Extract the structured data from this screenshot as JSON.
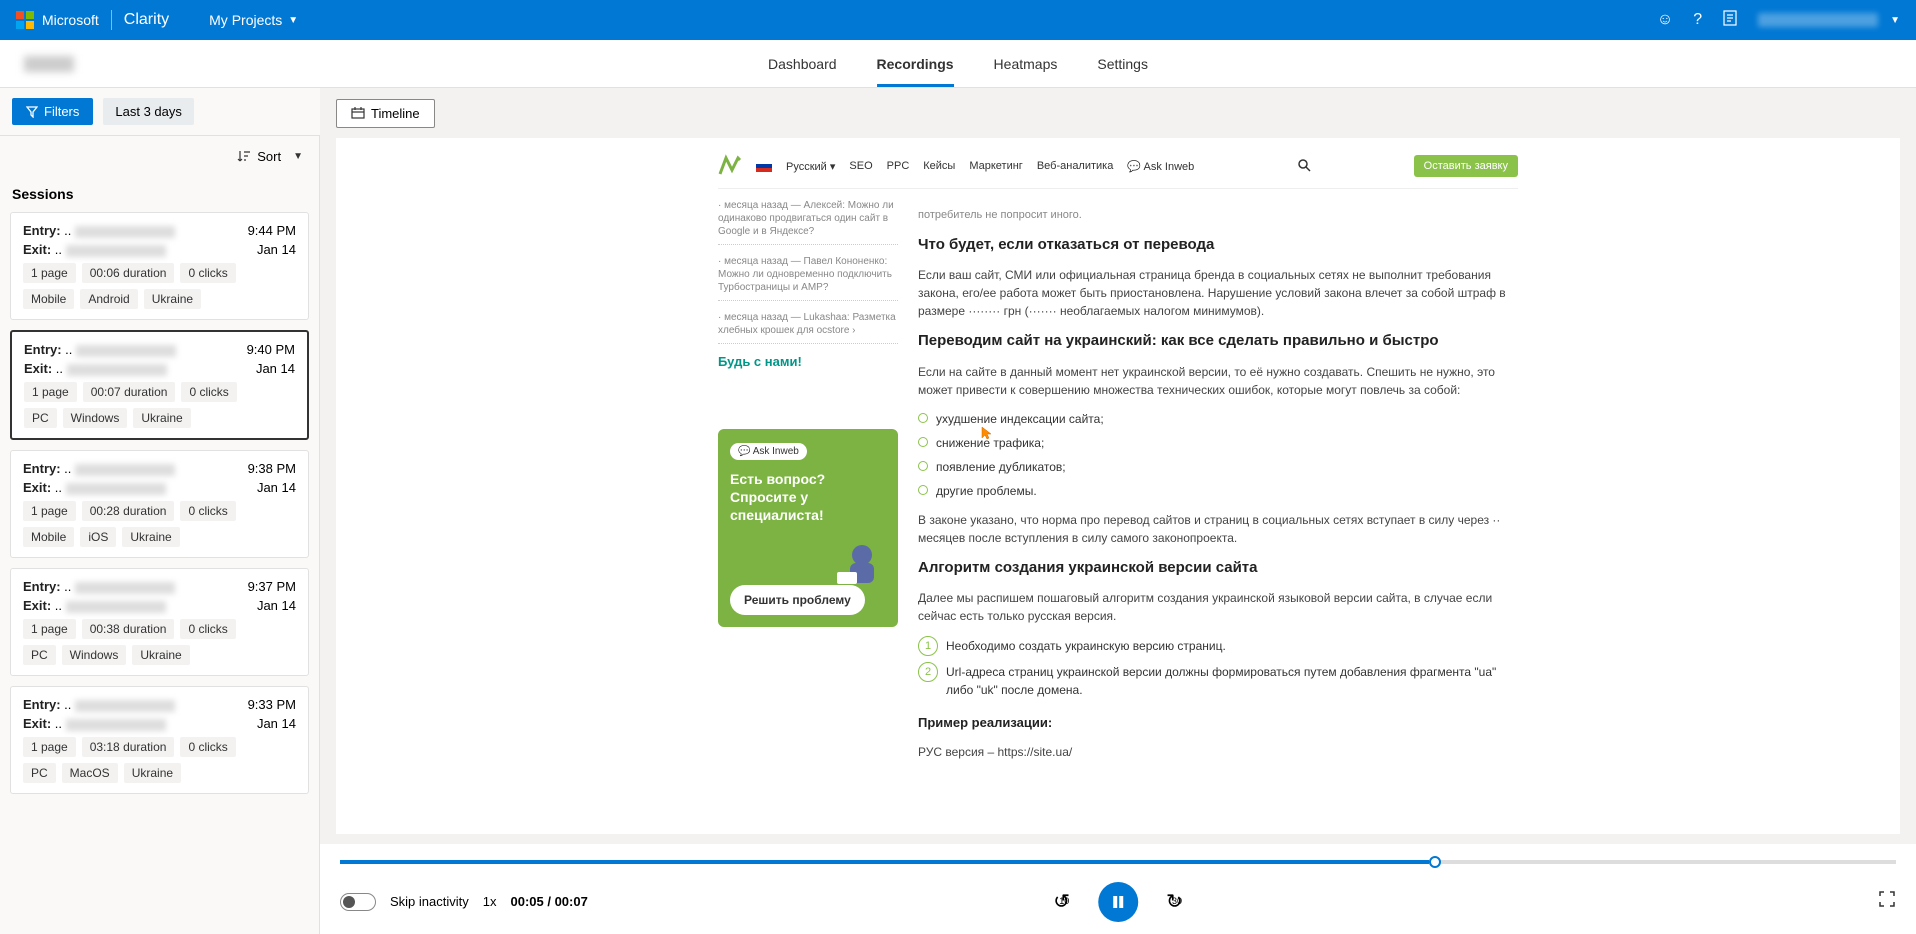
{
  "header": {
    "microsoft": "Microsoft",
    "brand": "Clarity",
    "projects": "My Projects"
  },
  "nav": {
    "dashboard": "Dashboard",
    "recordings": "Recordings",
    "heatmaps": "Heatmaps",
    "settings": "Settings"
  },
  "filters": {
    "button": "Filters",
    "chip": "Last 3 days"
  },
  "sort": "Sort",
  "timeline": "Timeline",
  "sessions_title": "Sessions",
  "sessions": [
    {
      "entry": "Entry:",
      "exit": "Exit:",
      "time": "9:44 PM",
      "date": "Jan 14",
      "pages": "1 page",
      "duration": "00:06 duration",
      "clicks": "0 clicks",
      "tags": [
        "Mobile",
        "Android",
        "Ukraine"
      ],
      "selected": false
    },
    {
      "entry": "Entry:",
      "exit": "Exit:",
      "time": "9:40 PM",
      "date": "Jan 14",
      "pages": "1 page",
      "duration": "00:07 duration",
      "clicks": "0 clicks",
      "tags": [
        "PC",
        "Windows",
        "Ukraine"
      ],
      "selected": true
    },
    {
      "entry": "Entry:",
      "exit": "Exit:",
      "time": "9:38 PM",
      "date": "Jan 14",
      "pages": "1 page",
      "duration": "00:28 duration",
      "clicks": "0 clicks",
      "tags": [
        "Mobile",
        "iOS",
        "Ukraine"
      ],
      "selected": false
    },
    {
      "entry": "Entry:",
      "exit": "Exit:",
      "time": "9:37 PM",
      "date": "Jan 14",
      "pages": "1 page",
      "duration": "00:38 duration",
      "clicks": "0 clicks",
      "tags": [
        "PC",
        "Windows",
        "Ukraine"
      ],
      "selected": false
    },
    {
      "entry": "Entry:",
      "exit": "Exit:",
      "time": "9:33 PM",
      "date": "Jan 14",
      "pages": "1 page",
      "duration": "03:18 duration",
      "clicks": "0 clicks",
      "tags": [
        "PC",
        "MacOS",
        "Ukraine"
      ],
      "selected": false
    }
  ],
  "controls": {
    "skip": "Skip inactivity",
    "speed": "1x",
    "time": "00:05 / 00:07",
    "back": "10",
    "fwd": "30"
  },
  "replay": {
    "nav": {
      "lang": "Русский",
      "seo": "SEO",
      "ppc": "PPC",
      "cases": "Кейсы",
      "marketing": "Маркетинг",
      "web": "Веб-аналитика",
      "ask": "Ask Inweb",
      "cta": "Оставить заявку"
    },
    "side_title": "Будь с нами!",
    "side_items": [
      "· месяца назад — Алексей: Можно ли одинаково продвигаться один сайт в Google и в Яндексе?",
      "· месяца назад — Павел Кононенко: Можно ли одновременно подключить Турбостраницы и AMP?",
      "· месяца назад — Lukashaa: Разметка хлебных крошек для ocstore ›"
    ],
    "promo_ask": "Ask Inweb",
    "promo_h": "Есть вопрос? Спросите у специалиста!",
    "promo_btn": "Решить проблему",
    "h1": "Что будет, если отказаться от перевода",
    "p1": "Если ваш сайт, СМИ или официальная страница бренда в социальных сетях не выполнит требования закона, его/ее работа может быть приостановлена. Нарушение условий закона влечет за собой штраф в размере ········ грн (······· необлагаемых налогом минимумов).",
    "h2": "Переводим сайт на украинский: как все сделать правильно и быстро",
    "p2": "Если на сайте в данный момент нет украинской версии, то её нужно создавать. Спешить не нужно, это может привести к совершению множества технических ошибок, которые могут повлечь за собой:",
    "li1": "ухудшение индексации сайта;",
    "li2": "снижение трафика;",
    "li3": "появление дубликатов;",
    "li4": "другие проблемы.",
    "p3": "В законе указано, что норма про перевод сайтов и страниц в социальных сетях вступает в силу через ·· месяцев после вступления в силу самого законопроекта.",
    "h3": "Алгоритм создания украинской версии сайта",
    "p4": "Далее мы распишем пошаговый алгоритм создания украинской языковой версии сайта, в случае если сейчас есть только русская версия.",
    "ol1": "Необходимо создать украинскую версию страниц.",
    "ol2": "Url-адреса страниц украинской версии должны формироваться путем добавления фрагмента \"ua\" либо \"uk\" после домена.",
    "h4": "Пример реализации:",
    "p5": "РУС версия – https://site.ua/"
  }
}
